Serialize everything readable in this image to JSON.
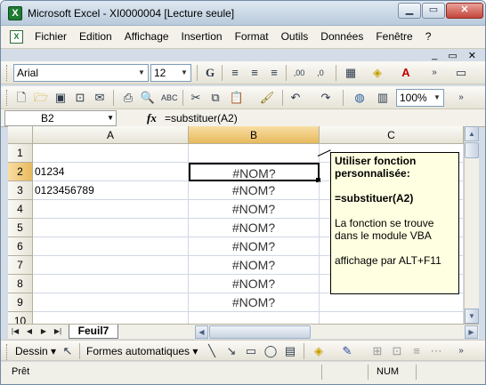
{
  "window": {
    "title": "Microsoft Excel - XI0000004  [Lecture seule]",
    "app_icon": "X",
    "buttons": {
      "minimize": "▁",
      "restore": "▭",
      "close": "✕"
    }
  },
  "menu": {
    "items": [
      "Fichier",
      "Edition",
      "Affichage",
      "Insertion",
      "Format",
      "Outils",
      "Données",
      "Fenêtre",
      "?"
    ],
    "right_controls": [
      "_",
      "▭",
      "✕"
    ]
  },
  "format_toolbar": {
    "font_name": "Arial",
    "font_size": "12",
    "bold_label": "G"
  },
  "standard_toolbar": {
    "zoom": "100%"
  },
  "formula_bar": {
    "name_box": "B2",
    "fx_label": "fx",
    "formula": "=substituer(A2)"
  },
  "grid": {
    "columns": [
      "A",
      "B",
      "C"
    ],
    "selected_column": "B",
    "rows": [
      {
        "num": "1",
        "a": "",
        "b": ""
      },
      {
        "num": "2",
        "a": "01234",
        "b": "#NOM?"
      },
      {
        "num": "3",
        "a": "0123456789",
        "b": "#NOM?"
      },
      {
        "num": "4",
        "a": "",
        "b": "#NOM?"
      },
      {
        "num": "5",
        "a": "",
        "b": "#NOM?"
      },
      {
        "num": "6",
        "a": "",
        "b": "#NOM?"
      },
      {
        "num": "7",
        "a": "",
        "b": "#NOM?"
      },
      {
        "num": "8",
        "a": "",
        "b": "#NOM?"
      },
      {
        "num": "9",
        "a": "",
        "b": "#NOM?"
      },
      {
        "num": "10",
        "a": "",
        "b": ""
      }
    ],
    "selected_row": "2"
  },
  "comment": {
    "title": "Utiliser fonction personnalisée:",
    "formula": "=substituer(A2)",
    "note1": "La fonction se trouve dans le module VBA",
    "note2": "affichage par ALT+F11"
  },
  "sheet_tabs": {
    "active": "Feuil7"
  },
  "drawing_toolbar": {
    "draw_label": "Dessin",
    "autoshapes_label": "Formes automatiques"
  },
  "status_bar": {
    "status": "Prêt",
    "num": "NUM"
  },
  "colors": {
    "selection_header": "#f8dea3",
    "comment_bg": "#ffffe1",
    "excel_green": "#1e7b34"
  }
}
